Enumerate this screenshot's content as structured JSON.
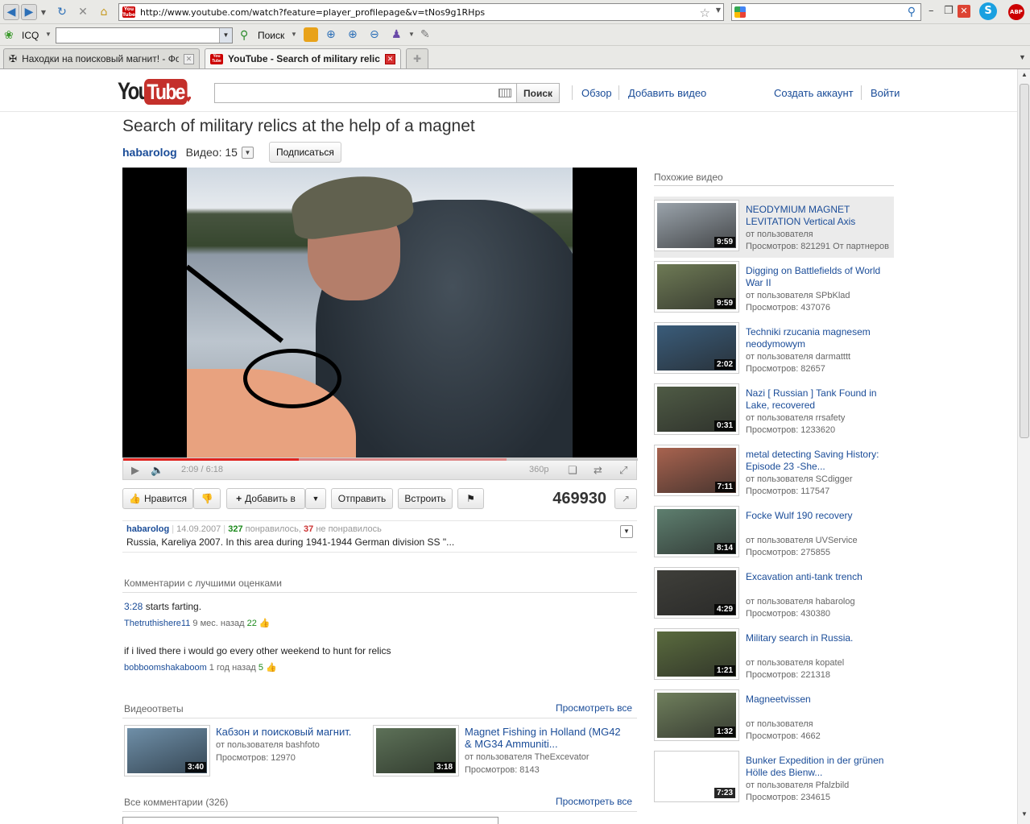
{
  "browser": {
    "url": "http://www.youtube.com/watch?feature=player_profilepage&v=tNos9g1RHps",
    "toolbar": {
      "icq_label": "ICQ",
      "search_label": "Поиск"
    },
    "tabs": [
      {
        "label": "Находки на поисковый магнит! - Фор...",
        "active": false
      },
      {
        "label": "YouTube - Search of military relic...",
        "active": true
      }
    ],
    "addon_badge": "ABP"
  },
  "yt": {
    "logo_you": "You",
    "logo_tube": "Tube",
    "search_button": "Поиск",
    "nav_browse": "Обзор",
    "nav_upload": "Добавить видео",
    "nav_create": "Создать аккаунт",
    "nav_signin": "Войти"
  },
  "video": {
    "title": "Search of military relics at the help of a magnet",
    "channel": "habarolog",
    "videos_label": "Видео: 15",
    "subscribe": "Подписаться",
    "time": "2:09 / 6:18",
    "progress": 0.341,
    "quality": "360p",
    "like": "Нравится",
    "add_to": "Добавить в",
    "share": "Отправить",
    "embed": "Встроить",
    "views": "469930",
    "info_channel": "habarolog",
    "info_date": "14.09.2007",
    "likes": "327",
    "likes_label": "понравилось,",
    "dislikes": "37",
    "dislikes_label": "не понравилось",
    "description": "Russia, Kareliya 2007. In this area during 1941-1944 German division SS \"..."
  },
  "top_comments": {
    "heading": "Комментарии с лучшими оценками",
    "items": [
      {
        "link": "3:28",
        "text": " starts farting.",
        "user": "Thetruthishere11",
        "when": " 9 мес. назад ",
        "votes": "22"
      },
      {
        "link": "",
        "text": "if i lived there i would go every other weekend to hunt for relics",
        "user": "bobboomshakaboom",
        "when": " 1 год назад ",
        "votes": "5"
      }
    ]
  },
  "video_responses": {
    "heading": "Видеоответы",
    "see_all": "Просмотреть все",
    "items": [
      {
        "title": "Кабзон и поисковый магнит.",
        "by": "от пользователя bashfoto",
        "views": "Просмотров: 12970",
        "duration": "3:40",
        "color": "#6f8fa8"
      },
      {
        "title": "Magnet Fishing in Holland (MG42 & MG34 Ammuniti...",
        "by": "от пользователя TheExcevator",
        "views": "Просмотров: 8143",
        "duration": "3:18",
        "color": "#5d7158"
      }
    ]
  },
  "all_comments": {
    "heading": "Все комментарии (326)",
    "see_all": "Просмотреть все"
  },
  "related": {
    "heading": "Похожие видео",
    "items": [
      {
        "title": "NEODYMIUM MAGNET LEVITATION Vertical Axis",
        "by": "от пользователя",
        "views": "Просмотров: 821291 От партнеров",
        "duration": "9:59",
        "color": "#9aa3ab"
      },
      {
        "title": "Digging on Battlefields of World War II",
        "by": "от пользователя SPbKlad",
        "views": "Просмотров: 437076",
        "duration": "9:59",
        "color": "#6e7a55"
      },
      {
        "title": "Techniki rzucania magnesem neodymowym",
        "by": "от пользователя darmatttt",
        "views": "Просмотров: 82657",
        "duration": "2:02",
        "color": "#3a5c7a"
      },
      {
        "title": "Nazi [ Russian ] Tank Found in Lake, recovered",
        "by": "от пользователя rrsafety",
        "views": "Просмотров: 1233620",
        "duration": "0:31",
        "color": "#4f5b45"
      },
      {
        "title": "metal detecting Saving History: Episode 23 -She...",
        "by": "от пользователя SCdigger",
        "views": "Просмотров: 117547",
        "duration": "7:11",
        "color": "#a8634f"
      },
      {
        "title": "Focke Wulf 190 recovery",
        "by": "от пользователя UVService",
        "views": "Просмотров: 275855",
        "duration": "8:14",
        "color": "#5e7f6f"
      },
      {
        "title": "Excavation anti-tank trench",
        "by": "от пользователя habarolog",
        "views": "Просмотров: 430380",
        "duration": "4:29",
        "color": "#3f3f3a"
      },
      {
        "title": "Military search in Russia.",
        "by": "от пользователя kopatel",
        "views": "Просмотров: 221318",
        "duration": "1:21",
        "color": "#5a6b3e"
      },
      {
        "title": "Magneetvissen",
        "by": "от пользователя",
        "views": "Просмотров: 4662",
        "duration": "1:32",
        "color": "#6f7f5c"
      },
      {
        "title": "Bunker Expedition in der grünen Hölle des Bienw...",
        "by": "от пользователя Pfalzbild",
        "views": "Просмотров: 234615",
        "duration": "7:23",
        "color": "#ffffff"
      }
    ]
  }
}
